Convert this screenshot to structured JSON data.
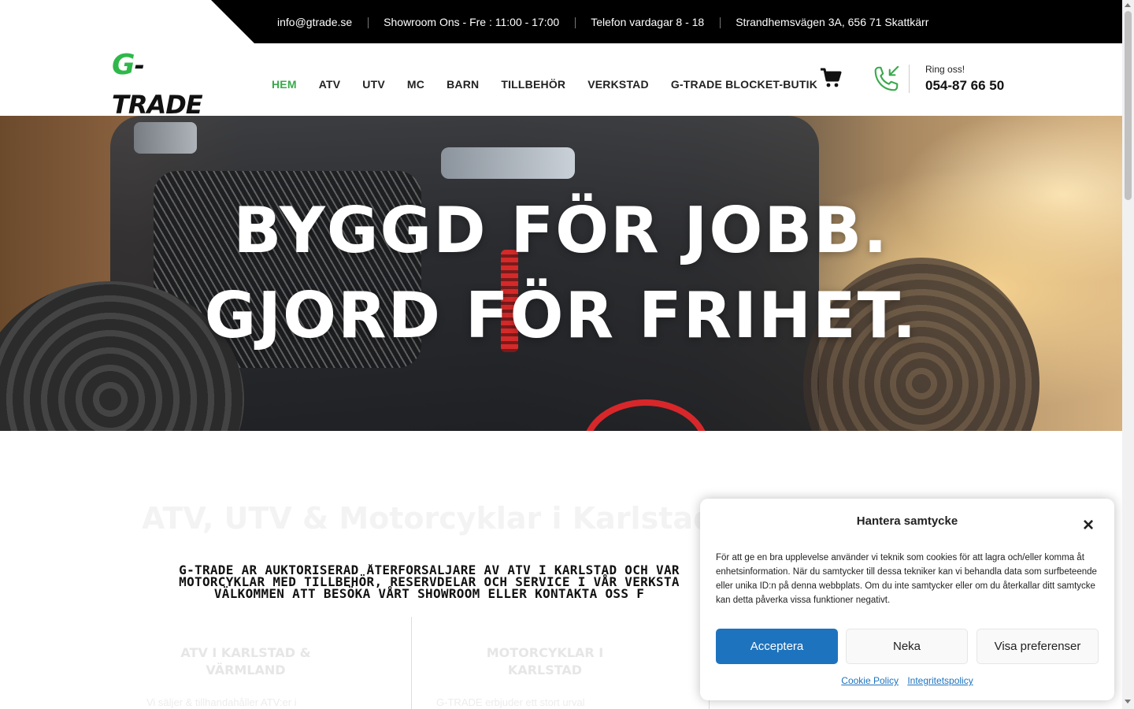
{
  "topbar": {
    "email": "info@gtrade.se",
    "showroom": "Showroom Ons - Fre : 11:00 - 17:00",
    "phone_hours": "Telefon vardagar 8 - 18",
    "address": "Strandhemsvägen 3A, 656 71 Skattkärr"
  },
  "logo": {
    "g": "G",
    "rest": "-TRADE"
  },
  "nav": {
    "items": [
      {
        "label": "HEM"
      },
      {
        "label": "ATV"
      },
      {
        "label": "UTV"
      },
      {
        "label": "MC"
      },
      {
        "label": "BARN"
      },
      {
        "label": "TILLBEHÖR"
      },
      {
        "label": "VERKSTAD"
      },
      {
        "label": "G-TRADE BLOCKET-BUTIK"
      }
    ],
    "active_index": 0
  },
  "header": {
    "call_label": "Ring oss!",
    "call_number": "054-87 66 50"
  },
  "hero": {
    "line1": "BYGGD FÖR JOBB.",
    "line2": "GJORD FÖR FRIHET."
  },
  "content": {
    "title": "ATV, UTV & Motorcyklar i Karlstad",
    "intro_lines": [
      "G-TRADE ÄR AUKTORISERAD ÅTERFÖRSÄLJARE AV ATV I KARLSTAD OCH VÄR",
      "MOTORCYKLAR MED TILLBEHÖR, RESERVDELAR OCH SERVICE I VÅR VERKSTA",
      "VÄLKOMMEN ATT BESÖKA VÅRT SHOWROOM ELLER KONTAKTA OSS F"
    ],
    "columns": [
      {
        "title_line1": "ATV I KARLSTAD &",
        "title_line2": "VÄRMLAND",
        "text": "Vi säljer & tillhandahåller ATV:er i"
      },
      {
        "title_line1": "MOTORCYKLAR I",
        "title_line2": "KARLSTAD",
        "text": "G-TRADE erbjuder ett stort urval"
      }
    ]
  },
  "cookie": {
    "title": "Hantera samtycke",
    "text": "För att ge en bra upplevelse använder vi teknik som cookies för att lagra och/eller komma åt enhetsinformation. När du samtycker till dessa tekniker kan vi behandla data som surfbeteende eller unika ID:n på denna webbplats. Om du inte samtycker eller om du återkallar ditt samtycke kan detta påverka vissa funktioner negativt.",
    "accept": "Acceptera",
    "deny": "Neka",
    "prefs": "Visa preferenser",
    "link_cookie": "Cookie Policy",
    "link_privacy": "Integritetspolicy",
    "close_glyph": "×"
  },
  "colors": {
    "accent_green": "#38a94b",
    "brand_black": "#000000",
    "accept_blue": "#1e73be"
  }
}
